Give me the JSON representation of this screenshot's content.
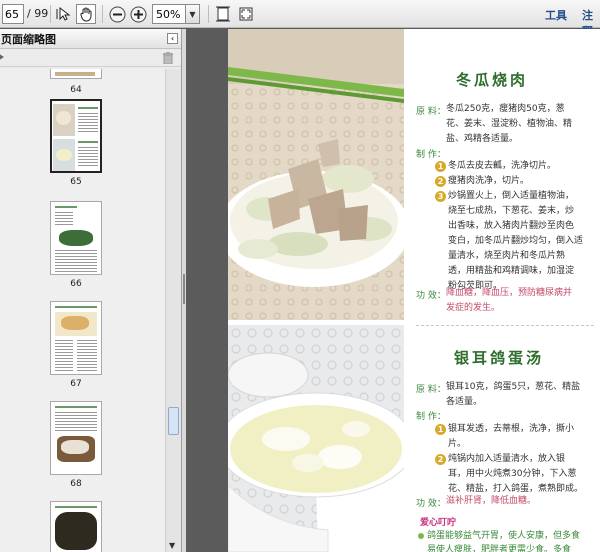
{
  "toolbar": {
    "page_current": "65",
    "page_total": "/ 99",
    "zoom": "50%",
    "menu_tools": "工具",
    "menu_comment": "注释"
  },
  "sidebar": {
    "title": "页面缩略图",
    "thumbnails": [
      {
        "label": "64"
      },
      {
        "label": "65"
      },
      {
        "label": "66"
      },
      {
        "label": "67"
      },
      {
        "label": "68"
      }
    ]
  },
  "recipe1": {
    "title": "冬瓜烧肉",
    "ingredients_label": "原  料：",
    "ingredients": [
      "冬瓜250克，瘦猪肉50克，葱",
      "花、姜末、湿淀粉、植物油、精",
      "盐、鸡精各适量。"
    ],
    "method_label": "制  作：",
    "steps": [
      {
        "num": "1",
        "lines": [
          "冬瓜去皮去瓤，洗净切片。"
        ]
      },
      {
        "num": "2",
        "lines": [
          "瘦猪肉洗净，切片。"
        ]
      },
      {
        "num": "3",
        "lines": [
          "炒锅置火上，倒入适量植物油，",
          "烧至七成热，下葱花、姜末，炒",
          "出香味，放入猪肉片翻炒至肉色",
          "变白，加冬瓜片翻炒均匀，倒入适",
          "量清水，烧至肉片和冬瓜片熟",
          "透，用精盐和鸡精调味，加湿淀",
          "粉勾芡即可。"
        ]
      }
    ],
    "effect_label": "功  效：",
    "effect": [
      "降血糖，降血压，预防糖尿病并",
      "发症的发生。"
    ]
  },
  "recipe2": {
    "title": "银耳鸽蛋汤",
    "ingredients_label": "原  料：",
    "ingredients": [
      "银耳10克，鸽蛋5只，葱花、精盐",
      "各适量。"
    ],
    "method_label": "制  作：",
    "steps": [
      {
        "num": "1",
        "lines": [
          "银耳发透，去蒂根，洗净，撕小",
          "片。"
        ]
      },
      {
        "num": "2",
        "lines": [
          "炖锅内加入适量清水，放入银",
          "耳，用中火炖煮30分钟，下入葱",
          "花、精盐，打入鸽蛋，煮熟即成。"
        ]
      }
    ],
    "effect_label": "功  效：",
    "effect": [
      "滋补肝肾，降低血糖。"
    ],
    "tip_title": "爱心叮咛",
    "tip": [
      "鸽蛋能够益气开胃，使人安康，但多食",
      "易使人瘦肤，肥胖者更需少食。多食"
    ]
  }
}
